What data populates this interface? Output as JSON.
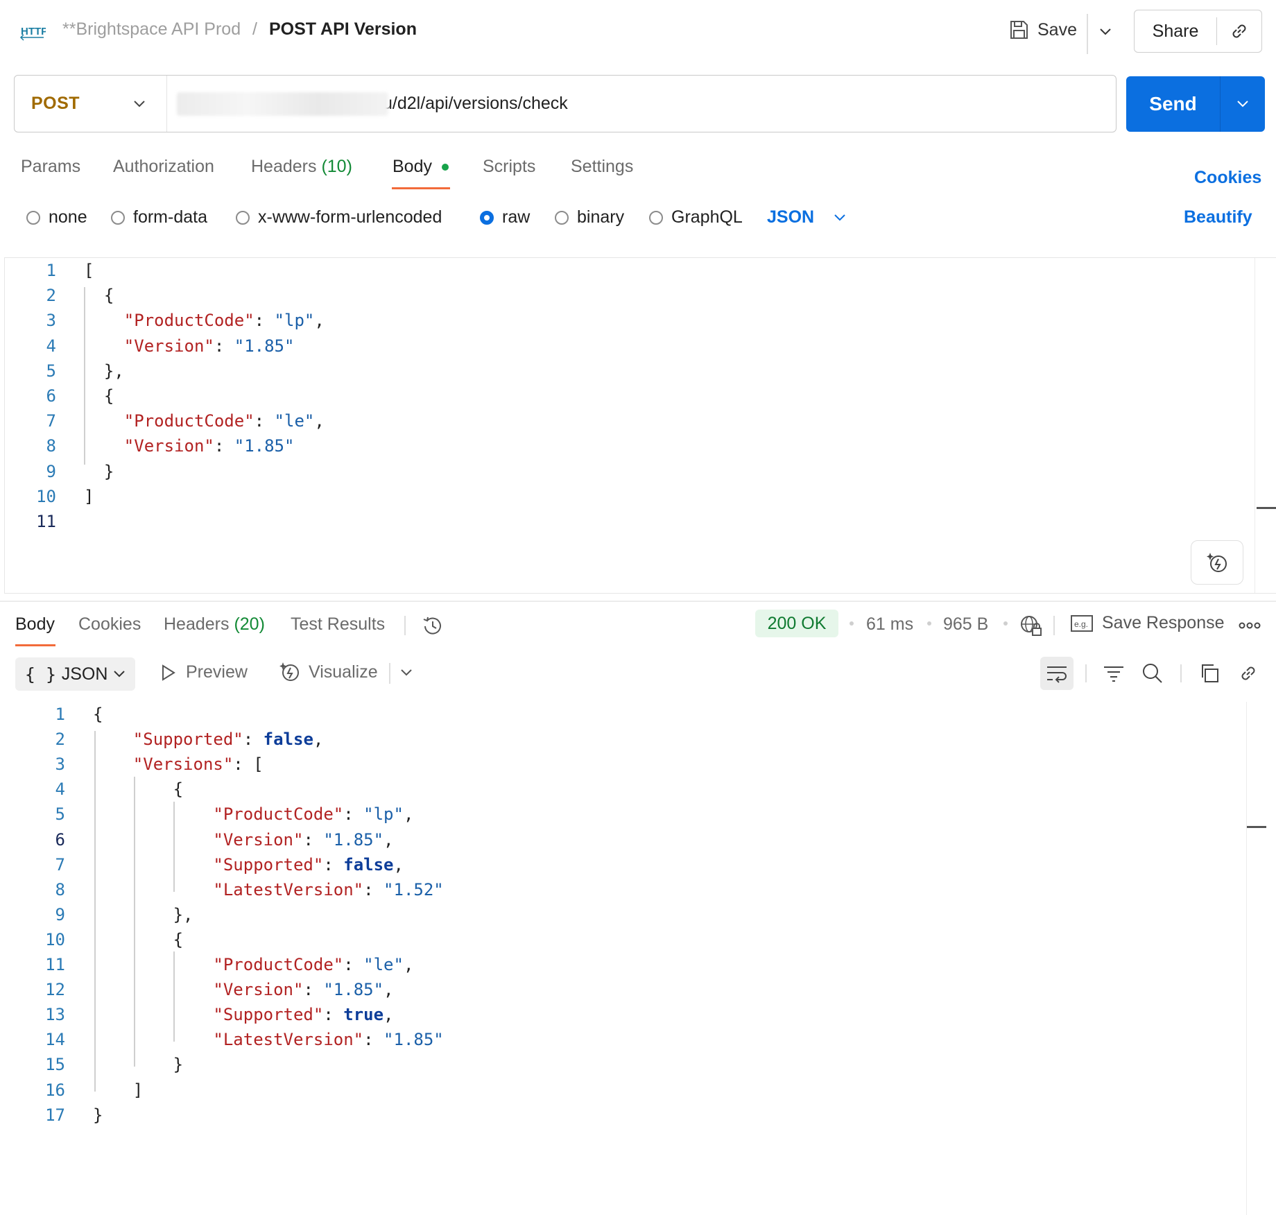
{
  "header": {
    "protocol_icon": "http-icon",
    "collection": "**Brightspace API Prod",
    "separator": "/",
    "request_name": "POST API Version",
    "save_label": "Save",
    "share_label": "Share"
  },
  "request": {
    "method": "POST",
    "url_visible": "u/d2l/api/versions/check",
    "send_label": "Send"
  },
  "request_tabs": {
    "params": "Params",
    "authorization": "Authorization",
    "headers": "Headers",
    "headers_count": "(10)",
    "body": "Body",
    "scripts": "Scripts",
    "settings": "Settings",
    "cookies": "Cookies"
  },
  "body_types": {
    "none": "none",
    "form_data": "form-data",
    "urlencoded": "x-www-form-urlencoded",
    "raw": "raw",
    "binary": "binary",
    "graphql": "GraphQL",
    "format": "JSON",
    "beautify": "Beautify",
    "selected": "raw"
  },
  "request_body": {
    "line_numbers": [
      "1",
      "2",
      "3",
      "4",
      "5",
      "6",
      "7",
      "8",
      "9",
      "10",
      "11"
    ],
    "lines": [
      [
        [
          "p",
          "["
        ]
      ],
      [
        [
          "p",
          "  {"
        ]
      ],
      [
        [
          "p",
          "    "
        ],
        [
          "k",
          "\"ProductCode\""
        ],
        [
          "p",
          ": "
        ],
        [
          "s",
          "\"lp\""
        ],
        [
          "p",
          ","
        ]
      ],
      [
        [
          "p",
          "    "
        ],
        [
          "k",
          "\"Version\""
        ],
        [
          "p",
          ": "
        ],
        [
          "s",
          "\"1.85\""
        ]
      ],
      [
        [
          "p",
          "  },"
        ]
      ],
      [
        [
          "p",
          "  {"
        ]
      ],
      [
        [
          "p",
          "    "
        ],
        [
          "k",
          "\"ProductCode\""
        ],
        [
          "p",
          ": "
        ],
        [
          "s",
          "\"le\""
        ],
        [
          "p",
          ","
        ]
      ],
      [
        [
          "p",
          "    "
        ],
        [
          "k",
          "\"Version\""
        ],
        [
          "p",
          ": "
        ],
        [
          "s",
          "\"1.85\""
        ]
      ],
      [
        [
          "p",
          "  }"
        ]
      ],
      [
        [
          "p",
          "]"
        ]
      ],
      []
    ]
  },
  "response_tabs": {
    "body": "Body",
    "cookies": "Cookies",
    "headers": "Headers",
    "headers_count": "(20)",
    "test_results": "Test Results"
  },
  "response_meta": {
    "status": "200 OK",
    "time": "61 ms",
    "size": "965 B",
    "save_response": "Save Response"
  },
  "response_toolbar": {
    "format_icon": "{ }",
    "format": "JSON",
    "preview": "Preview",
    "visualize": "Visualize"
  },
  "response_body": {
    "line_numbers": [
      "1",
      "2",
      "3",
      "4",
      "5",
      "6",
      "7",
      "8",
      "9",
      "10",
      "11",
      "12",
      "13",
      "14",
      "15",
      "16",
      "17"
    ],
    "lines": [
      [
        [
          "p",
          "{"
        ]
      ],
      [
        [
          "p",
          "    "
        ],
        [
          "k",
          "\"Supported\""
        ],
        [
          "p",
          ": "
        ],
        [
          "b",
          "false"
        ],
        [
          "p",
          ","
        ]
      ],
      [
        [
          "p",
          "    "
        ],
        [
          "k",
          "\"Versions\""
        ],
        [
          "p",
          ": ["
        ]
      ],
      [
        [
          "p",
          "        {"
        ]
      ],
      [
        [
          "p",
          "            "
        ],
        [
          "k",
          "\"ProductCode\""
        ],
        [
          "p",
          ": "
        ],
        [
          "s",
          "\"lp\""
        ],
        [
          "p",
          ","
        ]
      ],
      [
        [
          "p",
          "            "
        ],
        [
          "k",
          "\"Version\""
        ],
        [
          "p",
          ": "
        ],
        [
          "s",
          "\"1.85\""
        ],
        [
          "p",
          ","
        ]
      ],
      [
        [
          "p",
          "            "
        ],
        [
          "k",
          "\"Supported\""
        ],
        [
          "p",
          ": "
        ],
        [
          "b",
          "false"
        ],
        [
          "p",
          ","
        ]
      ],
      [
        [
          "p",
          "            "
        ],
        [
          "k",
          "\"LatestVersion\""
        ],
        [
          "p",
          ": "
        ],
        [
          "s",
          "\"1.52\""
        ]
      ],
      [
        [
          "p",
          "        },"
        ]
      ],
      [
        [
          "p",
          "        {"
        ]
      ],
      [
        [
          "p",
          "            "
        ],
        [
          "k",
          "\"ProductCode\""
        ],
        [
          "p",
          ": "
        ],
        [
          "s",
          "\"le\""
        ],
        [
          "p",
          ","
        ]
      ],
      [
        [
          "p",
          "            "
        ],
        [
          "k",
          "\"Version\""
        ],
        [
          "p",
          ": "
        ],
        [
          "s",
          "\"1.85\""
        ],
        [
          "p",
          ","
        ]
      ],
      [
        [
          "p",
          "            "
        ],
        [
          "k",
          "\"Supported\""
        ],
        [
          "p",
          ": "
        ],
        [
          "b",
          "true"
        ],
        [
          "p",
          ","
        ]
      ],
      [
        [
          "p",
          "            "
        ],
        [
          "k",
          "\"LatestVersion\""
        ],
        [
          "p",
          ": "
        ],
        [
          "s",
          "\"1.85\""
        ]
      ],
      [
        [
          "p",
          "        }"
        ]
      ],
      [
        [
          "p",
          "    ]"
        ]
      ],
      [
        [
          "p",
          "}"
        ]
      ]
    ]
  }
}
